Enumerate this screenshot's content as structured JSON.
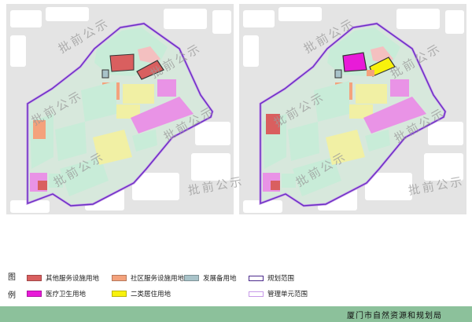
{
  "watermark_text": "批前公示",
  "legend": {
    "title_chars": [
      "图",
      "例"
    ],
    "items": [
      {
        "label": "其他服务设施用地",
        "color": "#d95f5f"
      },
      {
        "label": "社区服务设施用地",
        "color": "#f4a27c"
      },
      {
        "label": "发展备用地",
        "color": "#a9c3c9"
      },
      {
        "label": "规划范围",
        "color": "#4b2a8c"
      },
      {
        "label": "医疗卫生用地",
        "color": "#e81bd8"
      },
      {
        "label": "二类居住用地",
        "color": "#f8f20c"
      },
      {
        "label": "管理单元范围",
        "color": "#c79ae8"
      }
    ]
  },
  "footer": {
    "org_name": "厦门市自然资源和规划局"
  },
  "colors": {
    "residential_light": "#f1f0a4",
    "green_space": "#c8ecd8",
    "commercial_pink": "#e993e6",
    "map_background": "#e4e4e4",
    "block_white": "#ffffff"
  }
}
